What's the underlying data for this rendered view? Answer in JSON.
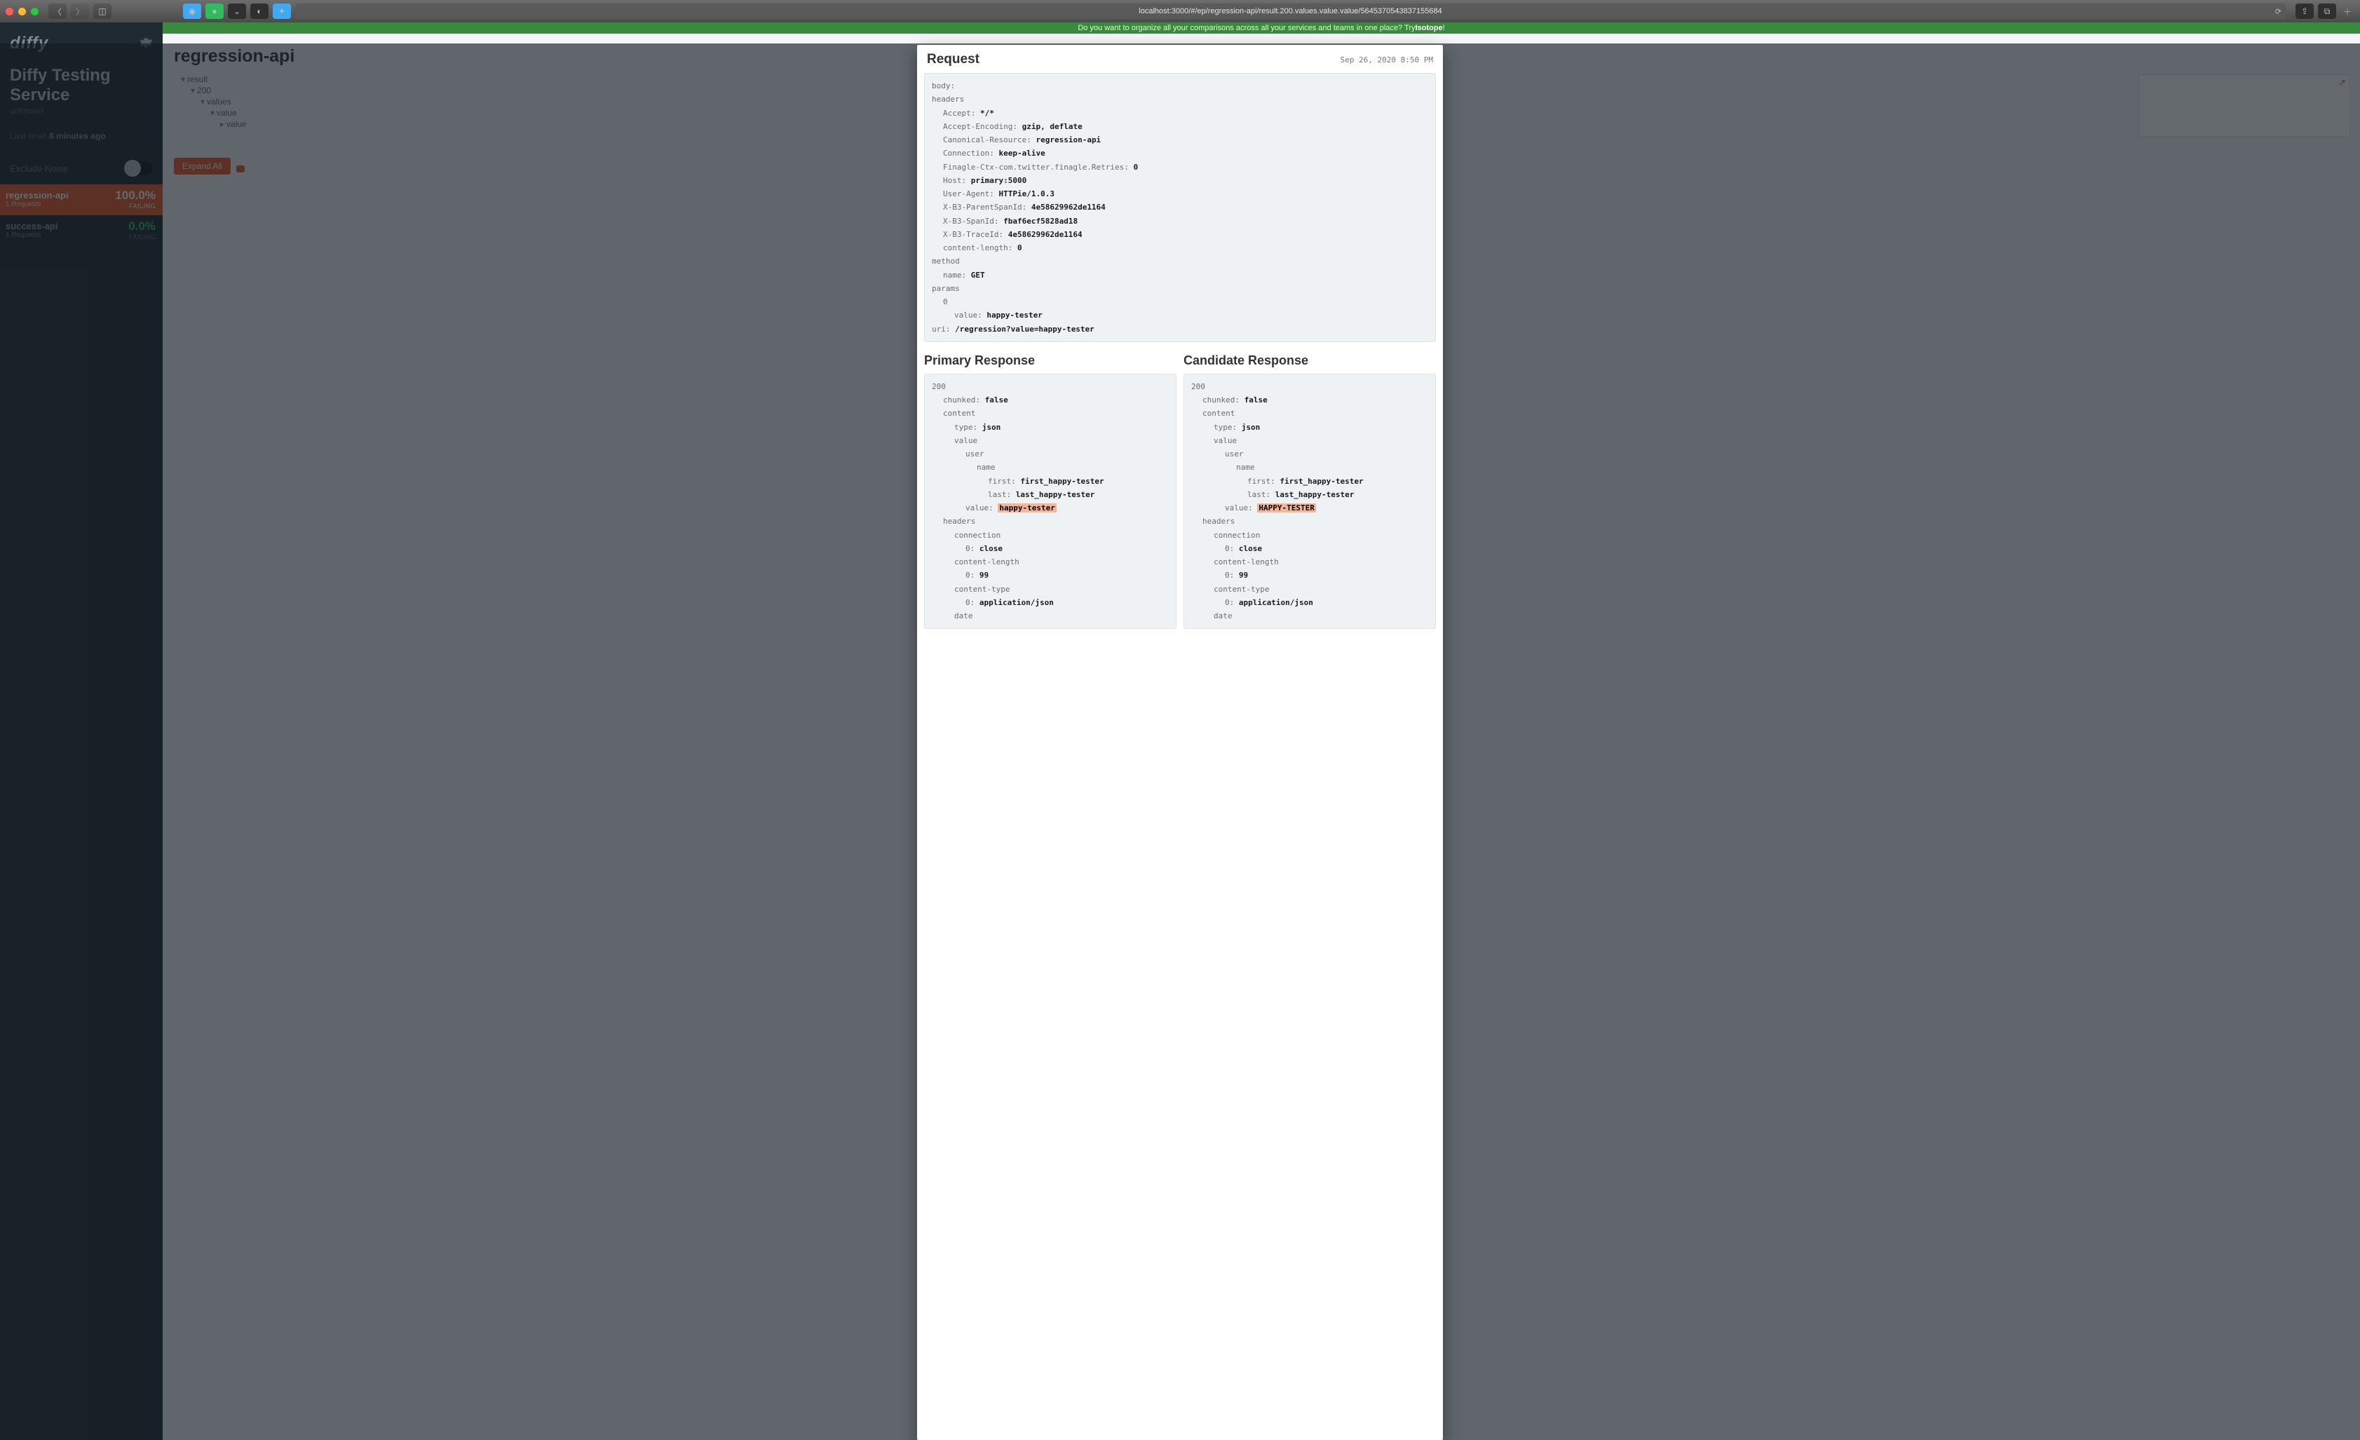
{
  "browser": {
    "url": "localhost:3000/#/ep/regression-api/result.200.values.value.value/5645370543837155684"
  },
  "sidebar": {
    "logo": "diffy",
    "title": "Diffy Testing Service",
    "subtitle": "unknown",
    "last_reset_label": "Last reset",
    "last_reset_value": "8 minutes ago",
    "exclude_noise_label": "Exclude Noise",
    "endpoints": [
      {
        "name": "regression-api",
        "requests_label": "1  Requests",
        "pct": "100.0%",
        "status": "FAILING",
        "active": true
      },
      {
        "name": "success-api",
        "requests_label": "1  Requests",
        "pct": "0.0%",
        "status": "FAILING",
        "active": false
      }
    ]
  },
  "promo": {
    "text_pre": "Do you want to organize all your comparisons across all your services and teams in one place? Try ",
    "link": "Isotope",
    "text_post": "!"
  },
  "page": {
    "title": "regression-api",
    "tree": [
      "result",
      "200",
      "values",
      "value",
      "value"
    ],
    "expand_btn": "Expand All"
  },
  "modal": {
    "request_title": "Request",
    "timestamp": "Sep 26, 2020 8:50 PM",
    "request": {
      "body_label": "body:",
      "headers_label": "headers",
      "headers": [
        {
          "k": "Accept:",
          "v": "*/*"
        },
        {
          "k": "Accept-Encoding:",
          "v": "gzip, deflate"
        },
        {
          "k": "Canonical-Resource:",
          "v": "regression-api"
        },
        {
          "k": "Connection:",
          "v": "keep-alive"
        },
        {
          "k": "Finagle-Ctx-com.twitter.finagle.Retries:",
          "v": "0"
        },
        {
          "k": "Host:",
          "v": "primary:5000"
        },
        {
          "k": "User-Agent:",
          "v": "HTTPie/1.0.3"
        },
        {
          "k": "X-B3-ParentSpanId:",
          "v": "4e58629962de1164"
        },
        {
          "k": "X-B3-SpanId:",
          "v": "fbaf6ecf5828ad18"
        },
        {
          "k": "X-B3-TraceId:",
          "v": "4e58629962de1164"
        },
        {
          "k": "content-length:",
          "v": "0"
        }
      ],
      "method_label": "method",
      "method_name_k": "name:",
      "method_name_v": "GET",
      "params_label": "params",
      "params_index": "0",
      "params_value_k": "value:",
      "params_value_v": "happy-tester",
      "uri_k": "uri:",
      "uri_v": "/regression?value=happy-tester"
    },
    "primary_title": "Primary Response",
    "candidate_title": "Candidate Response",
    "primary": {
      "status": "200",
      "chunked_k": "chunked:",
      "chunked_v": "false",
      "content_label": "content",
      "type_k": "type:",
      "type_v": "json",
      "value_label": "value",
      "user_label": "user",
      "name_label": "name",
      "first_k": "first:",
      "first_v": "first_happy-tester",
      "last_k": "last:",
      "last_v": "last_happy-tester",
      "inner_value_k": "value:",
      "inner_value_v": "happy-tester",
      "headers_label": "headers",
      "conn_label": "connection",
      "conn_k": "0:",
      "conn_v": "close",
      "clen_label": "content-length",
      "clen_k": "0:",
      "clen_v": "99",
      "ctype_label": "content-type",
      "ctype_k": "0:",
      "ctype_v": "application/json",
      "date_label": "date"
    },
    "candidate": {
      "status": "200",
      "chunked_k": "chunked:",
      "chunked_v": "false",
      "content_label": "content",
      "type_k": "type:",
      "type_v": "json",
      "value_label": "value",
      "user_label": "user",
      "name_label": "name",
      "first_k": "first:",
      "first_v": "first_happy-tester",
      "last_k": "last:",
      "last_v": "last_happy-tester",
      "inner_value_k": "value:",
      "inner_value_v": "HAPPY-TESTER",
      "headers_label": "headers",
      "conn_label": "connection",
      "conn_k": "0:",
      "conn_v": "close",
      "clen_label": "content-length",
      "clen_k": "0:",
      "clen_v": "99",
      "ctype_label": "content-type",
      "ctype_k": "0:",
      "ctype_v": "application/json",
      "date_label": "date"
    }
  }
}
